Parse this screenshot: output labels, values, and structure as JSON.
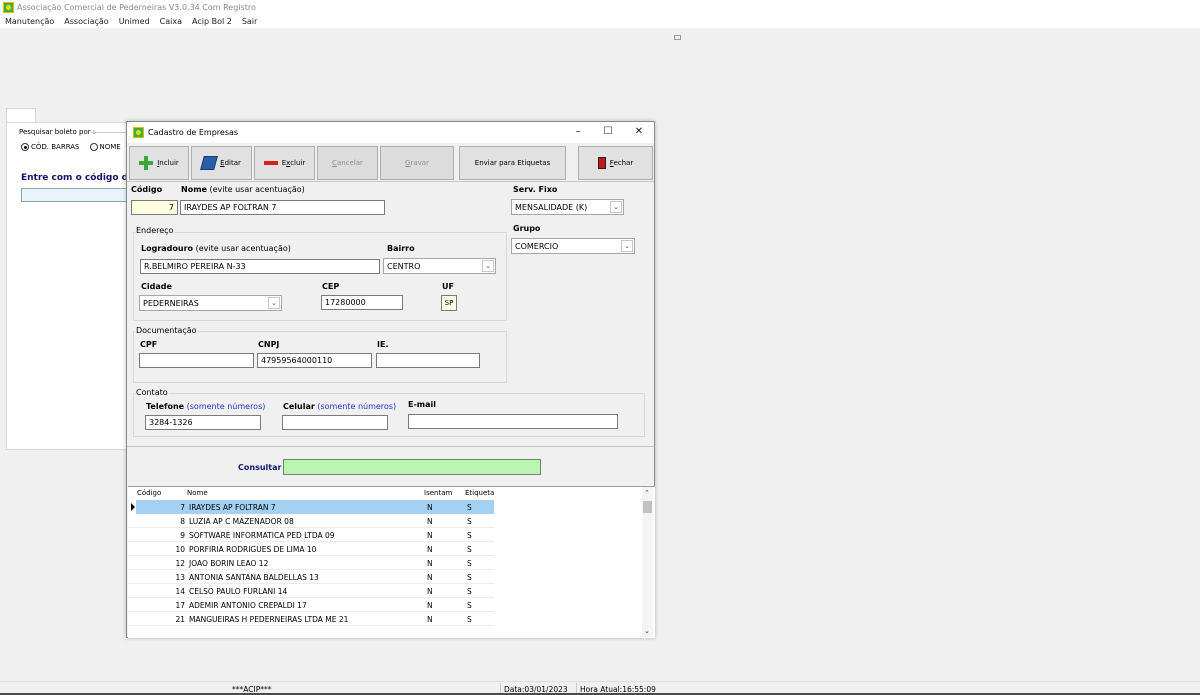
{
  "main_window": {
    "title": "Associação Comercial de Pederneiras V3.0.34  Com Registro",
    "menu": [
      "Manutenção",
      "Associação",
      "Unimed",
      "Caixa",
      "Acip Bol 2",
      "Sair"
    ]
  },
  "background_panel": {
    "search_by_label": "Pesquisar boleto por :",
    "radio_barcode_label": "CÓD. BARRAS",
    "radio_name_label": "NOME",
    "entry_label": "Entre com o código de ba"
  },
  "dialog": {
    "title": "Cadastro de Empresas",
    "toolbar": {
      "incluir_first": "I",
      "incluir_rest": "ncluir",
      "editar_first": "E",
      "editar_rest": "ditar",
      "excluir_pre": "E",
      "excluir_u": "x",
      "excluir_rest": "cluir",
      "cancelar_first": "C",
      "cancelar_rest": "ancelar",
      "gravar_first": "G",
      "gravar_rest": "ravar",
      "enviar_label": "Enviar para Etiquetas",
      "fechar_first": "F",
      "fechar_rest": "echar"
    },
    "form": {
      "codigo_label": "Código",
      "codigo_value": "7",
      "nome_label": "Nome",
      "nome_hint": "(evite usar acentuação)",
      "nome_value": "IRAYDES AP  FOLTRAN 7",
      "serv_fixo_label": "Serv. Fixo",
      "serv_fixo_value": "MENSALIDADE (K)",
      "grupo_label": "Grupo",
      "grupo_value": "COMERCIO",
      "endereco_group": "Endereço",
      "logradouro_label": "Logradouro",
      "logradouro_hint": "(evite usar acentuação)",
      "logradouro_value": "R.BELMIRO PEREIRA N-33",
      "bairro_label": "Bairro",
      "bairro_value": "CENTRO",
      "cidade_label": "Cidade",
      "cidade_value": "PEDERNEIRAS",
      "cep_label": "CEP",
      "cep_value": "17280000",
      "uf_label": "UF",
      "uf_value": "SP",
      "documentacao_group": "Documentação",
      "cpf_label": "CPF",
      "cpf_value": "",
      "cnpj_label": "CNPJ",
      "cnpj_value": "47959564000110",
      "ie_label": "IE.",
      "ie_value": "",
      "contato_group": "Contato",
      "telefone_label": "Telefone",
      "telefone_hint": "(somente números)",
      "telefone_value": "3284-1326",
      "celular_label": "Celular",
      "celular_hint": "(somente números)",
      "celular_value": "",
      "email_label": "E-mail",
      "email_value": "",
      "consultar_label": "Consultar",
      "consultar_value": ""
    },
    "grid": {
      "columns": [
        "Código",
        "Nome",
        "Isentam",
        "Etiqueta"
      ],
      "rows": [
        {
          "codigo": "7",
          "nome": "IRAYDES AP  FOLTRAN 7",
          "isentam": "N",
          "etiqueta": "S"
        },
        {
          "codigo": "8",
          "nome": "LUZIA AP C MAZENADOR 08",
          "isentam": "N",
          "etiqueta": "S"
        },
        {
          "codigo": "9",
          "nome": "SOFTWARE INFORMATICA PED LTDA 09",
          "isentam": "N",
          "etiqueta": "S"
        },
        {
          "codigo": "10",
          "nome": "PORFIRIA RODRIGUES DE LIMA 10",
          "isentam": "N",
          "etiqueta": "S"
        },
        {
          "codigo": "12",
          "nome": "JOAO BORIN LEAO  12",
          "isentam": "N",
          "etiqueta": "S"
        },
        {
          "codigo": "13",
          "nome": "ANTONIA SANTANA BALDELLAS 13",
          "isentam": "N",
          "etiqueta": "S"
        },
        {
          "codigo": "14",
          "nome": "CELSO PAULO FURLANI 14",
          "isentam": "N",
          "etiqueta": "S"
        },
        {
          "codigo": "17",
          "nome": "ADEMIR ANTONIO CREPALDI 17",
          "isentam": "N",
          "etiqueta": "S"
        },
        {
          "codigo": "21",
          "nome": "MANGUEIRAS H PEDERNEIRAS LTDA ME 21",
          "isentam": "N",
          "etiqueta": "S"
        }
      ]
    }
  },
  "statusbar": {
    "center_text": "***ACIP***",
    "date": "Data:03/01/2023",
    "time": "Hora Atual:16:55:09"
  }
}
